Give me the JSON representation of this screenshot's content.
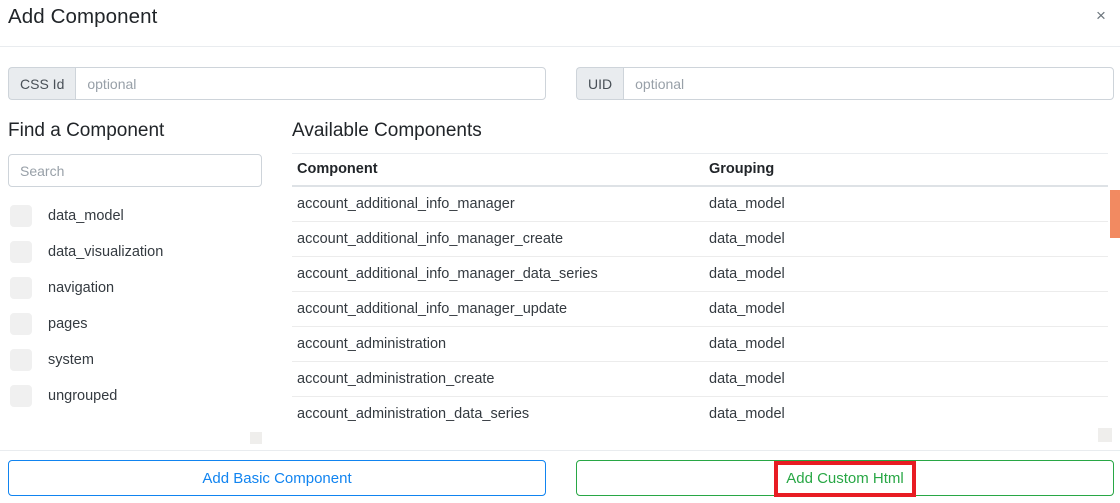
{
  "header": {
    "title": "Add Component",
    "close_label": "×"
  },
  "id_row": {
    "css_id": {
      "label": "CSS Id",
      "value": "",
      "placeholder": "optional"
    },
    "uid": {
      "label": "UID",
      "value": "",
      "placeholder": "optional"
    }
  },
  "left_panel": {
    "title": "Find a Component",
    "search": {
      "value": "",
      "placeholder": "Search"
    },
    "groups": [
      {
        "label": "data_model",
        "checked": false
      },
      {
        "label": "data_visualization",
        "checked": false
      },
      {
        "label": "navigation",
        "checked": false
      },
      {
        "label": "pages",
        "checked": false
      },
      {
        "label": "system",
        "checked": false
      },
      {
        "label": "ungrouped",
        "checked": false
      }
    ]
  },
  "right_panel": {
    "title": "Available Components",
    "columns": [
      "Component",
      "Grouping"
    ],
    "rows": [
      {
        "component": "account_additional_info_manager",
        "grouping": "data_model"
      },
      {
        "component": "account_additional_info_manager_create",
        "grouping": "data_model"
      },
      {
        "component": "account_additional_info_manager_data_series",
        "grouping": "data_model"
      },
      {
        "component": "account_additional_info_manager_update",
        "grouping": "data_model"
      },
      {
        "component": "account_administration",
        "grouping": "data_model"
      },
      {
        "component": "account_administration_create",
        "grouping": "data_model"
      },
      {
        "component": "account_administration_data_series",
        "grouping": "data_model"
      }
    ]
  },
  "footer": {
    "basic_button": "Add Basic Component",
    "custom_button": "Add Custom Html"
  },
  "colors": {
    "basic_button": "#1184f0",
    "custom_button": "#28a745",
    "highlight": "#e81c23",
    "scrollbar_thumb": "#f28a61"
  }
}
